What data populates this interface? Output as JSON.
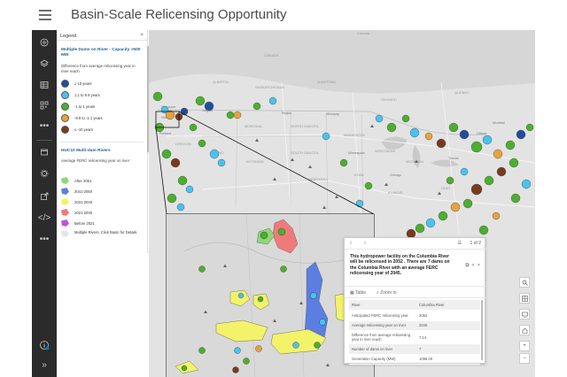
{
  "header": {
    "title": "Basin-Scale Relicensing Opportunity"
  },
  "toolbar": {
    "icons": [
      "add-icon",
      "layers-icon",
      "table-icon",
      "qr-icon",
      "more-icon",
      "bookmark-icon",
      "settings-icon",
      "share-icon",
      "code-icon",
      "more-icon",
      "info-icon",
      "expand-icon"
    ],
    "info_badge_color": "#0079c1"
  },
  "legend": {
    "title": "Legend",
    "close": "×",
    "layer1": {
      "title": "Multiple Dams on River - Capacity >500 MW",
      "subtitle": "Difference from average relicensing year in river reach",
      "items": [
        {
          "label": "≥ 10 years",
          "color": "#1f4e9e"
        },
        {
          "label": "1.1 to 9.9 years",
          "color": "#49c3f0"
        },
        {
          "label": "-1 to 1 years",
          "color": "#4caf2f"
        },
        {
          "label": "-9.9 to -1.1 years",
          "color": "#e8a33a"
        },
        {
          "label": "≤ -10 years",
          "color": "#7a3a1e"
        }
      ]
    },
    "layer2": {
      "title": "HUC10 Multi-dam Rivers",
      "subtitle": "Average FERC relicensing year on river",
      "items": [
        {
          "label": "After 2051",
          "color": "#8fd67a"
        },
        {
          "label": "2041-2050",
          "color": "#5b7ee0"
        },
        {
          "label": "2031-2040",
          "color": "#f3f36a"
        },
        {
          "label": "2021-2030",
          "color": "#f07a7a"
        },
        {
          "label": "Before 2021",
          "color": "#b25ad6"
        },
        {
          "label": "Multiple Rivers. Click Basin for Details",
          "color": "#d8d8d8"
        }
      ]
    }
  },
  "map": {
    "labels": [
      "Canada",
      "CANADA",
      "ALBERTA",
      "SASKATCHEWAN",
      "MANITOBA",
      "ONTARIO",
      "QUEBEC",
      "Calgary",
      "Regina",
      "Winnipeg",
      "Vancouver",
      "Seattle",
      "Portland",
      "MONTANA",
      "NORTH DAKOTA",
      "SOUTH DAKOTA",
      "MINNESOTA",
      "WISCONSIN",
      "MICHIGAN",
      "IOWA",
      "NEBRASKA",
      "ILLINOIS",
      "OHIO",
      "WYOMING",
      "IDAHO",
      "OREGON",
      "Toronto",
      "Chicago",
      "Minneapolis",
      "Montreal",
      "Ottawa"
    ]
  },
  "popup": {
    "count": "1 of 2",
    "description": "This hydropower facility on the Columbia River will be relicensed in 2052 . There are 7 dams on the Columbia River with an average FERC relicensing year of 2045.",
    "actions": {
      "table": "Table",
      "zoom": "Zoom to"
    },
    "rows": [
      {
        "key": "River",
        "value": "Columbia River"
      },
      {
        "key": "Anticipated FERC relicensing year",
        "value": "2052"
      },
      {
        "key": "Average relicensing year on river",
        "value": "2045"
      },
      {
        "key": "Difference from average relicensing year in river reach",
        "value": "7.14"
      },
      {
        "key": "Number of dams on river",
        "value": "7"
      },
      {
        "key": "Generation Capacity (MW)",
        "value": "1098.00"
      }
    ]
  }
}
